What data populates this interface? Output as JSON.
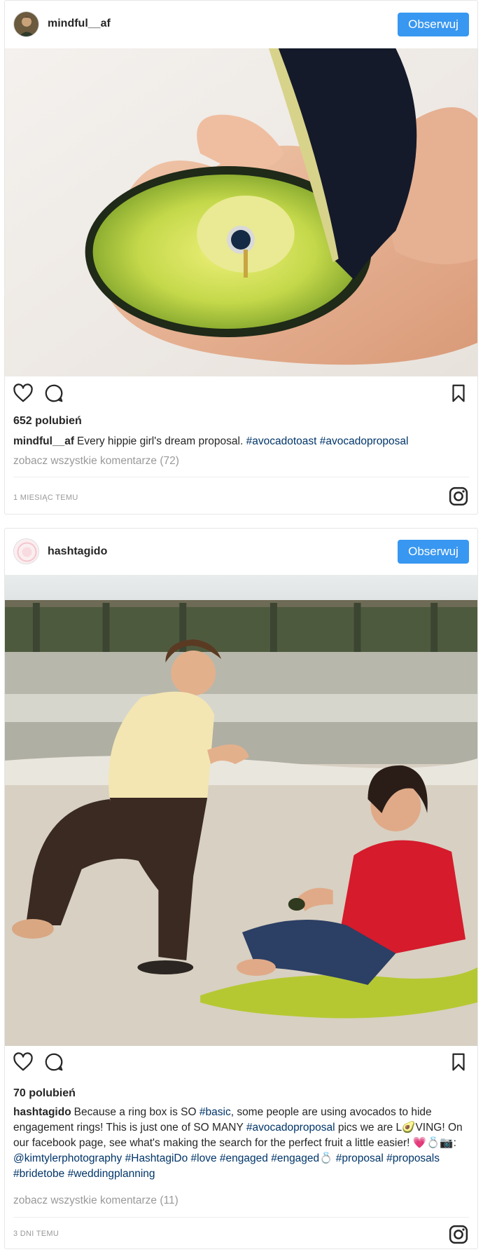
{
  "posts": [
    {
      "username": "mindful__af",
      "follow_label": "Obserwuj",
      "likes": "652 polubień",
      "caption": {
        "text": "Every hippie girl's dream proposal. ",
        "hashtags": [
          "#avocadotoast",
          "#avocadoproposal"
        ]
      },
      "view_comments": "zobacz wszystkie komentarze (72)",
      "time": "1 MIESIĄC TEMU"
    },
    {
      "username": "hashtagido",
      "follow_label": "Obserwuj",
      "likes": "70 polubień",
      "caption": {
        "part1": "Because a ring box is SO ",
        "tag1": "#basic",
        "part2": ", some people are using avocados to hide engagement rings! This is just one of SO MANY ",
        "tag2": "#avocadoproposal",
        "part3": " pics we are L🥑VING! On our facebook page, see what's making the search for the perfect fruit a little easier! 💗💍📷: ",
        "tag3": "@kimtylerphotography",
        "tag4": "#HashtagiDo",
        "tag5": "#love",
        "tag6": "#engaged",
        "tag7": "#engaged💍",
        "tag8": "#proposal",
        "tag9": "#proposals",
        "tag10": "#bridetobe",
        "tag11": "#weddingplanning"
      },
      "view_comments": "zobacz wszystkie komentarze (11)",
      "time": "3 DNI TEMU"
    }
  ],
  "icons": {
    "like": "heart-icon",
    "comment": "comment-icon",
    "save": "bookmark-icon",
    "brand": "instagram-icon"
  },
  "colors": {
    "follow_button": "#3897f0",
    "hashtag": "#003569",
    "muted_text": "#999999"
  }
}
